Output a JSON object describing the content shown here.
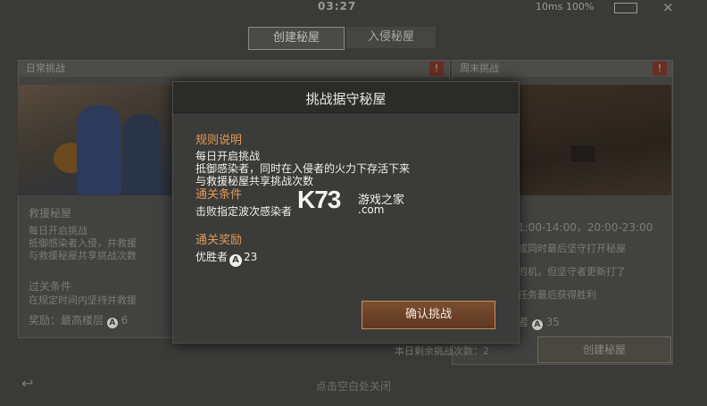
{
  "status_bar": {
    "time": "03:27",
    "network": "10ms  100%",
    "close_glyph": "×"
  },
  "top_tabs": [
    {
      "label": "创建秘屋",
      "active": true
    },
    {
      "label": "入侵秘屋",
      "active": false
    }
  ],
  "left_panel": {
    "header": "日常挑战",
    "title": "救援秘屋",
    "desc_lines": [
      "每日开启挑战",
      "抵御感染者入侵，并救援",
      "与救援秘屋共享挑战次数"
    ],
    "condition_label": "过关条件",
    "condition_text": "在规定时间内坚持并救援",
    "reward_text": "奖励：最高楼层",
    "reward_value": "6"
  },
  "right_panel": {
    "header": "周末挑战",
    "time_text": "1:00-14:00，20:00-23:00",
    "desc_lines": [
      "或同时最后坚守打开秘屋",
      "的机，但坚守者更新打了",
      "任务最后获得胜利"
    ],
    "reward_value": "35",
    "create_button": "创建秘屋"
  },
  "remaining_text": "本日剩余挑战次数：2",
  "bottom_hint": "点击空白处关闭",
  "modal": {
    "title": "挑战据守秘屋",
    "rules_title": "规则说明",
    "rules_lines": [
      "每日开启挑战",
      "抵御感染者，同时在入侵者的火力下存活下来",
      "与救援秘屋共享挑战次数"
    ],
    "clear_title": "通关条件",
    "clear_text": "击败指定波次感染者",
    "reward_title": "通关奖励",
    "reward_prefix": "优胜者",
    "reward_value": "23",
    "confirm_label": "确认挑战"
  },
  "watermark": {
    "brand": "K73",
    "cn": "游戏之家",
    "domain": ".com"
  },
  "colors": {
    "accent_orange": "#e09a55",
    "button_border": "#c89060",
    "modal_bg": "#3b3b39"
  },
  "icons": [
    "wifi-icon",
    "battery-icon",
    "close-icon",
    "back-arrow-icon",
    "coin-icon",
    "info-icon"
  ]
}
